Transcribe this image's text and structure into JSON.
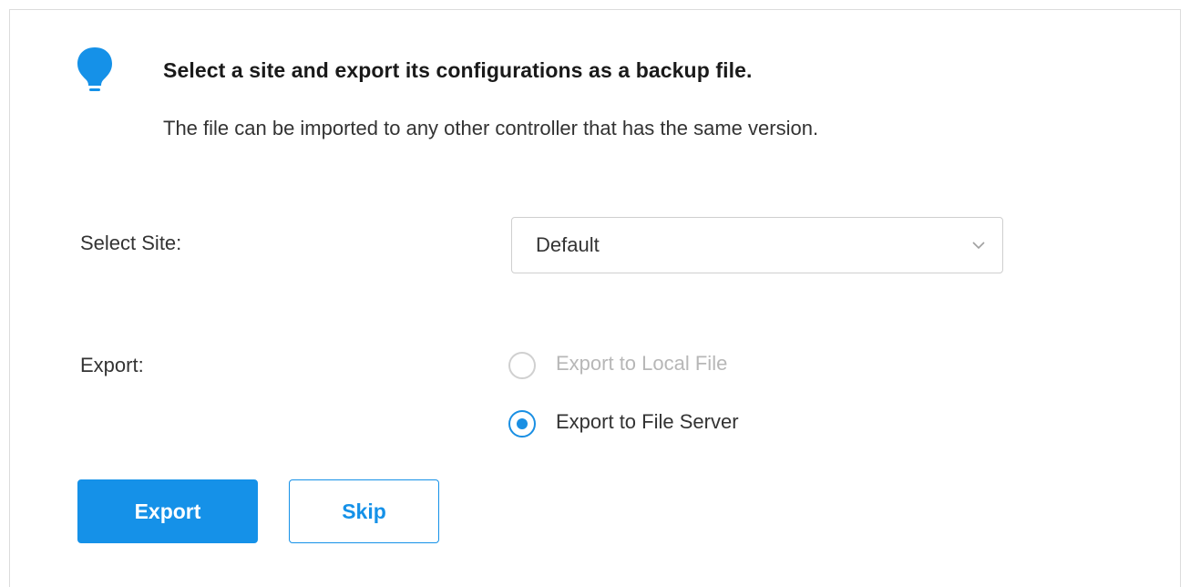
{
  "tip": {
    "icon": "lightbulb-icon",
    "title": "Select a site and export its configurations as a backup file.",
    "description": "The file can be imported to any other controller that has the same version."
  },
  "form": {
    "site_label": "Select Site:",
    "site_value": "Default",
    "site_dropdown_icon": "chevron-down-icon",
    "export_label": "Export:",
    "export_options": [
      {
        "label": "Export to Local File",
        "selected": false,
        "disabled": true
      },
      {
        "label": "Export to File Server",
        "selected": true,
        "disabled": false
      }
    ]
  },
  "actions": {
    "export_label": "Export",
    "skip_label": "Skip"
  },
  "colors": {
    "accent": "#1591e8",
    "text": "#333333",
    "disabled_text": "#b7b7b7",
    "border": "#cfcfcf"
  }
}
